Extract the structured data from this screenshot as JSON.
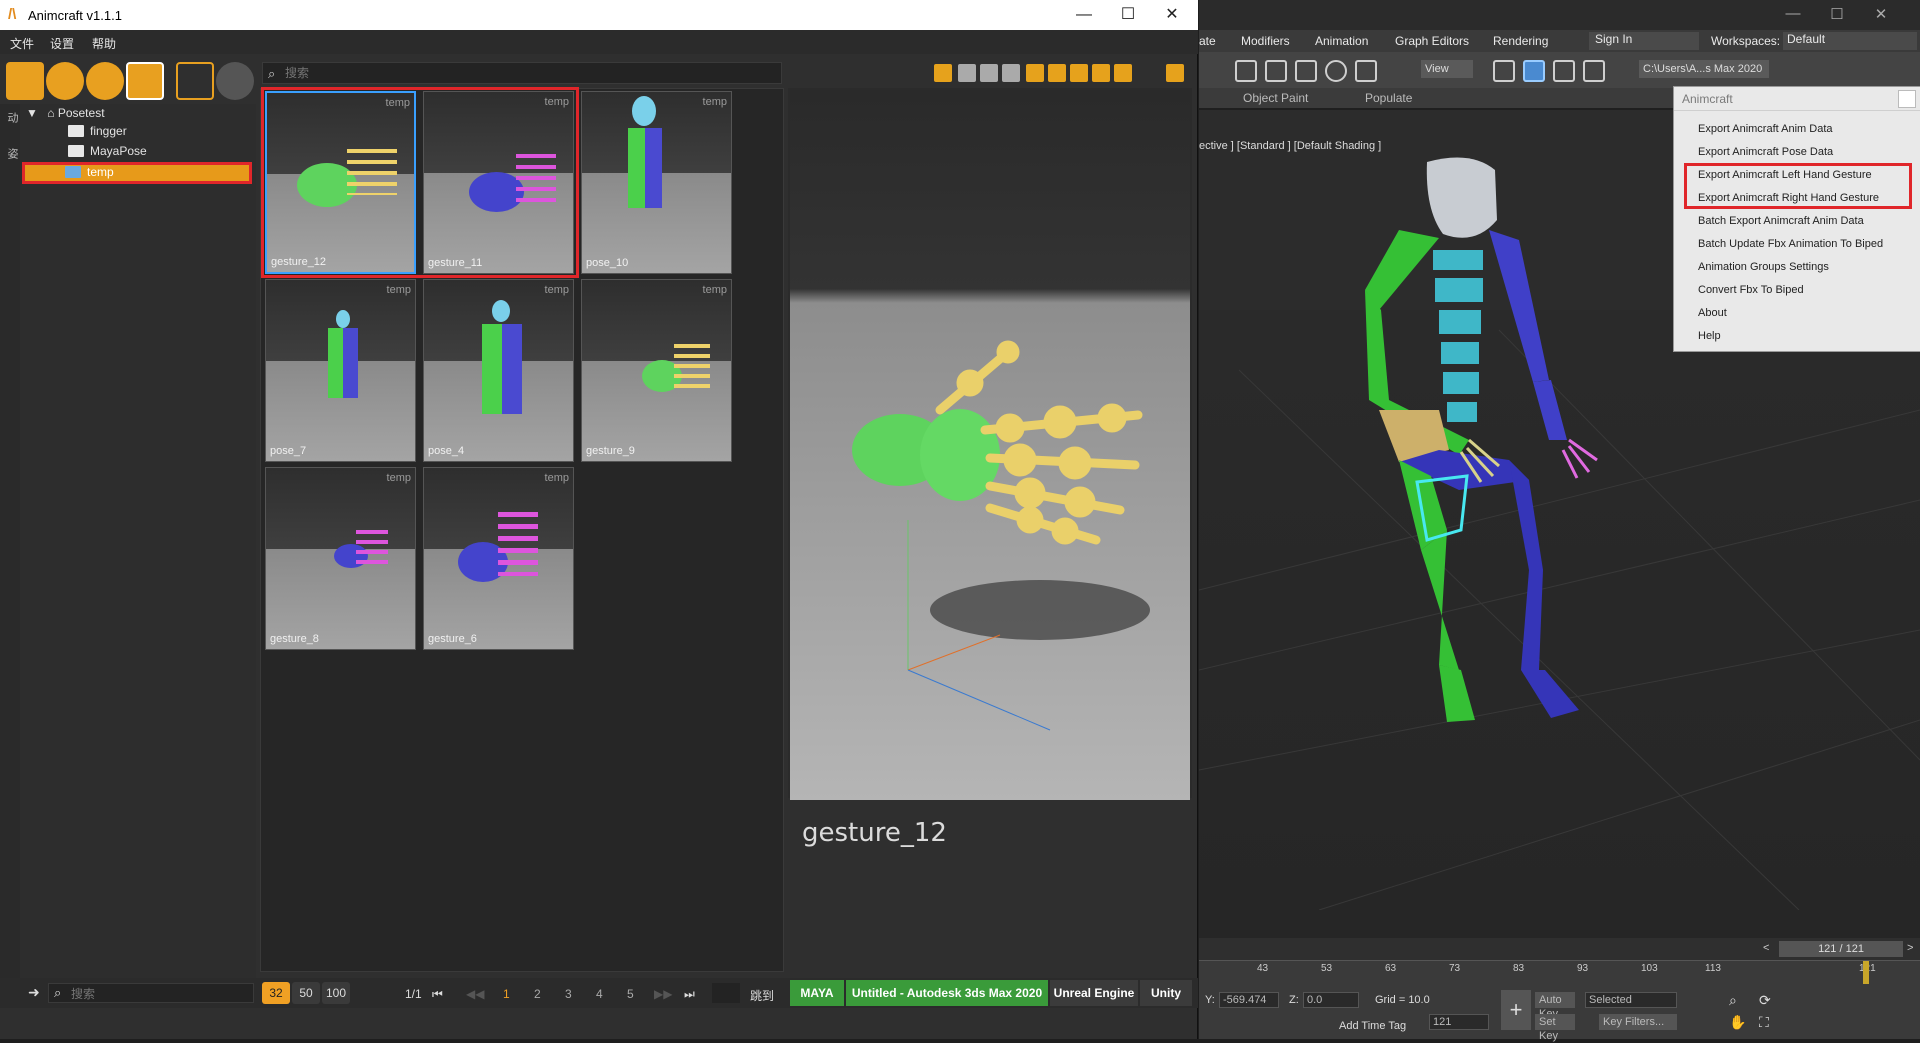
{
  "animcraft": {
    "title": "Animcraft v1.1.1",
    "menu": [
      "文件",
      "设置",
      "帮助"
    ],
    "window_buttons": [
      "—",
      "☐",
      "✕"
    ],
    "search_placeholder": "搜索",
    "left_tabs": [
      "动",
      "姿"
    ],
    "tree": {
      "root": "Posetest",
      "children": [
        "fingger",
        "MayaPose",
        "temp"
      ],
      "selected": "temp"
    },
    "thumbnails": [
      {
        "name": "gesture_12",
        "tag": "temp"
      },
      {
        "name": "gesture_11",
        "tag": "temp"
      },
      {
        "name": "pose_10",
        "tag": "temp"
      },
      {
        "name": "pose_7",
        "tag": "temp"
      },
      {
        "name": "pose_4",
        "tag": "temp"
      },
      {
        "name": "gesture_9",
        "tag": "temp"
      },
      {
        "name": "gesture_8",
        "tag": "temp"
      },
      {
        "name": "gesture_6",
        "tag": "temp"
      }
    ],
    "preview_title": "gesture_12",
    "bottom_search_placeholder": "搜索",
    "page_sizes": [
      "32",
      "50",
      "100"
    ],
    "page_info": "1/1",
    "pages": [
      "1",
      "2",
      "3",
      "4",
      "5"
    ],
    "first_glyph": "⏮",
    "prev_glyph": "◀◀",
    "next_glyph": "▶▶",
    "last_glyph": "⏭",
    "jump_label": "跳到",
    "engines": [
      {
        "label": "MAYA",
        "color": "#3a9b3a"
      },
      {
        "label": "Untitled - Autodesk 3ds Max 2020",
        "color": "#3a9b3a"
      },
      {
        "label": "Unreal Engine",
        "color": "#3b3b3b"
      },
      {
        "label": "Unity",
        "color": "#3b3b3b"
      }
    ]
  },
  "max": {
    "menu": [
      "ate",
      "Modifiers",
      "Animation",
      "Graph Editors",
      "Rendering"
    ],
    "signin": "Sign In",
    "workspaces_label": "Workspaces:",
    "workspace_value": "Default",
    "view_select": "View",
    "path_select": "C:\\Users\\A...s Max 2020",
    "tabs": [
      "Object Paint",
      "Populate"
    ],
    "viewport_label": "ective ] [Standard ] [Default Shading ]",
    "dropdown": {
      "header": "Animcraft",
      "items": [
        "Export Animcraft Anim Data",
        "Export Animcraft Pose Data",
        "Export Animcraft Left Hand Gesture",
        "Export Animcraft Right Hand Gesture",
        "Batch Export Animcraft Anim Data",
        "Batch Update Fbx Animation To Biped",
        "Animation Groups Settings",
        "Convert Fbx To Biped",
        "About",
        "Help"
      ]
    },
    "frame_counter": "121 / 121",
    "frame_ticks": [
      "43",
      "53",
      "63",
      "73",
      "83",
      "93",
      "103",
      "113",
      "121"
    ],
    "status": {
      "y_label": "Y:",
      "y_value": "-569.474",
      "z_label": "Z:",
      "z_value": "0.0",
      "grid": "Grid = 10.0",
      "add_time_tag": "Add Time Tag",
      "auto_key": "Auto Key",
      "set_key": "Set Key",
      "selected": "Selected",
      "key_filters": "Key Filters...",
      "frame_field": "121"
    }
  },
  "colors": {
    "accent": "#f0a024",
    "highlight_red": "#e0262a",
    "green_bone": "#4bd04b",
    "blue_bone": "#4a4ad0",
    "cyan_spine": "#47b8c8"
  }
}
